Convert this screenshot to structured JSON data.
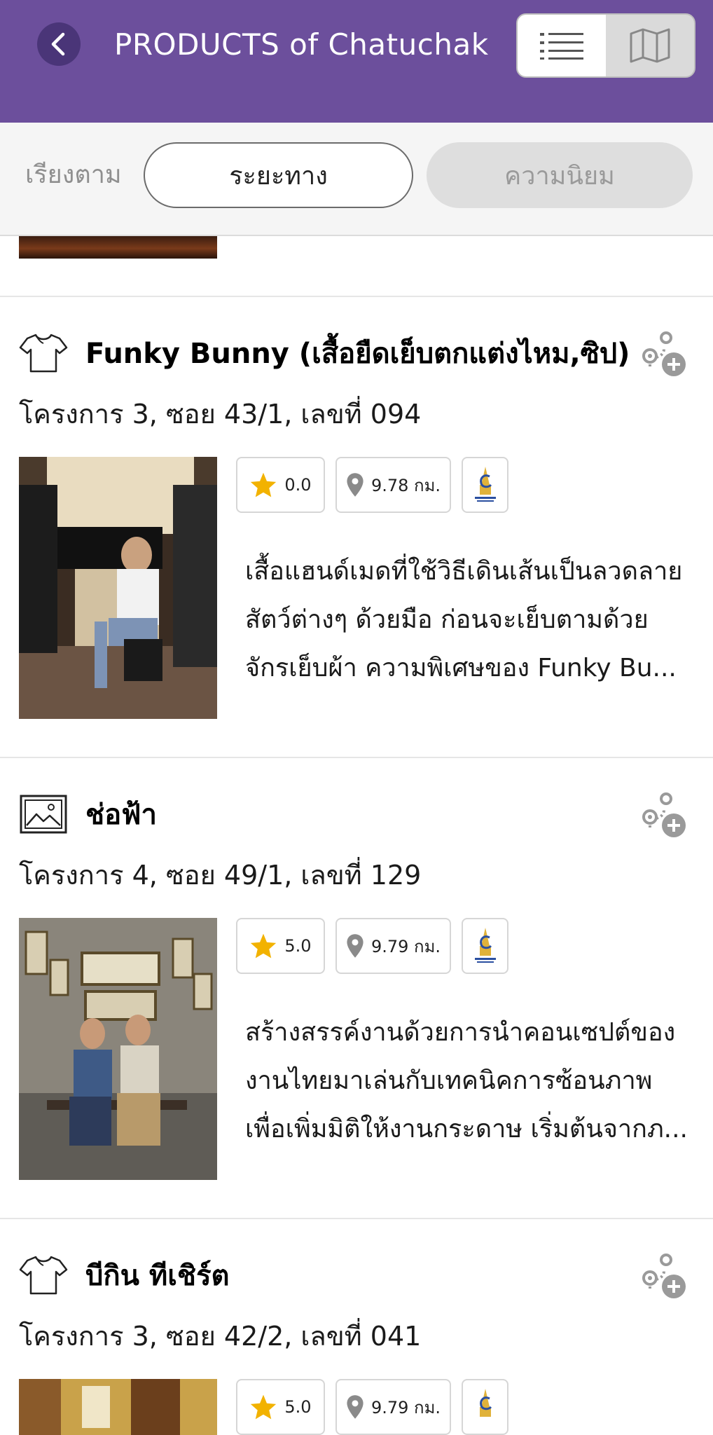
{
  "header": {
    "title": "PRODUCTS of Chatuchak",
    "back_icon": "chevron-left-icon",
    "view_modes": [
      {
        "name": "list",
        "icon": "list-icon",
        "active": true
      },
      {
        "name": "map",
        "icon": "map-icon",
        "active": false
      }
    ],
    "bg_color": "#6c4f9c"
  },
  "sort": {
    "label": "เรียงตาม",
    "options": [
      {
        "label": "ระยะทาง",
        "active": true
      },
      {
        "label": "ความนิยม",
        "active": false
      }
    ]
  },
  "shops": [
    {
      "category_icon": "tshirt-icon",
      "name": "Funky Bunny (เสื้อยืดเย็บตกแต่งไหม,ซิป)",
      "address": "โครงการ 3, ซอย 43/1, เลขที่ 094",
      "rating": "0.0",
      "distance": "9.78 กม.",
      "logo_icon": "chatuchak-logo-icon",
      "description_lines": [
        "เสื้อแฮนด์เมดที่ใช้วิธีเดินเส้นเป็นลวดลาย",
        "สัตว์ต่างๆ ด้วยมือ ก่อนจะเย็บตามด้วย",
        "จักรเย็บผ้า ความพิเศษของ Funky Bu..."
      ]
    },
    {
      "category_icon": "picture-icon",
      "name": "ช่อฟ้า",
      "address": "โครงการ 4, ซอย 49/1, เลขที่ 129",
      "rating": "5.0",
      "distance": "9.79 กม.",
      "logo_icon": "chatuchak-logo-icon",
      "description_lines": [
        "สร้างสรรค์งานด้วยการนำคอนเซปต์ของ",
        "งานไทยมาเล่นกับเทคนิคการซ้อนภาพ",
        "เพื่อเพิ่มมิติให้งานกระดาษ เริ่มต้นจากภ..."
      ]
    },
    {
      "category_icon": "tshirt-icon",
      "name": "บีกิน ทีเชิร์ต",
      "address": "โครงการ 3, ซอย 42/2, เลขที่ 041",
      "rating": "5.0",
      "distance": "9.79 กม.",
      "logo_icon": "chatuchak-logo-icon",
      "description_lines": []
    }
  ],
  "colors": {
    "star": "#f2b200",
    "pin": "#8a8a8a",
    "accent": "#6c4f9c"
  }
}
